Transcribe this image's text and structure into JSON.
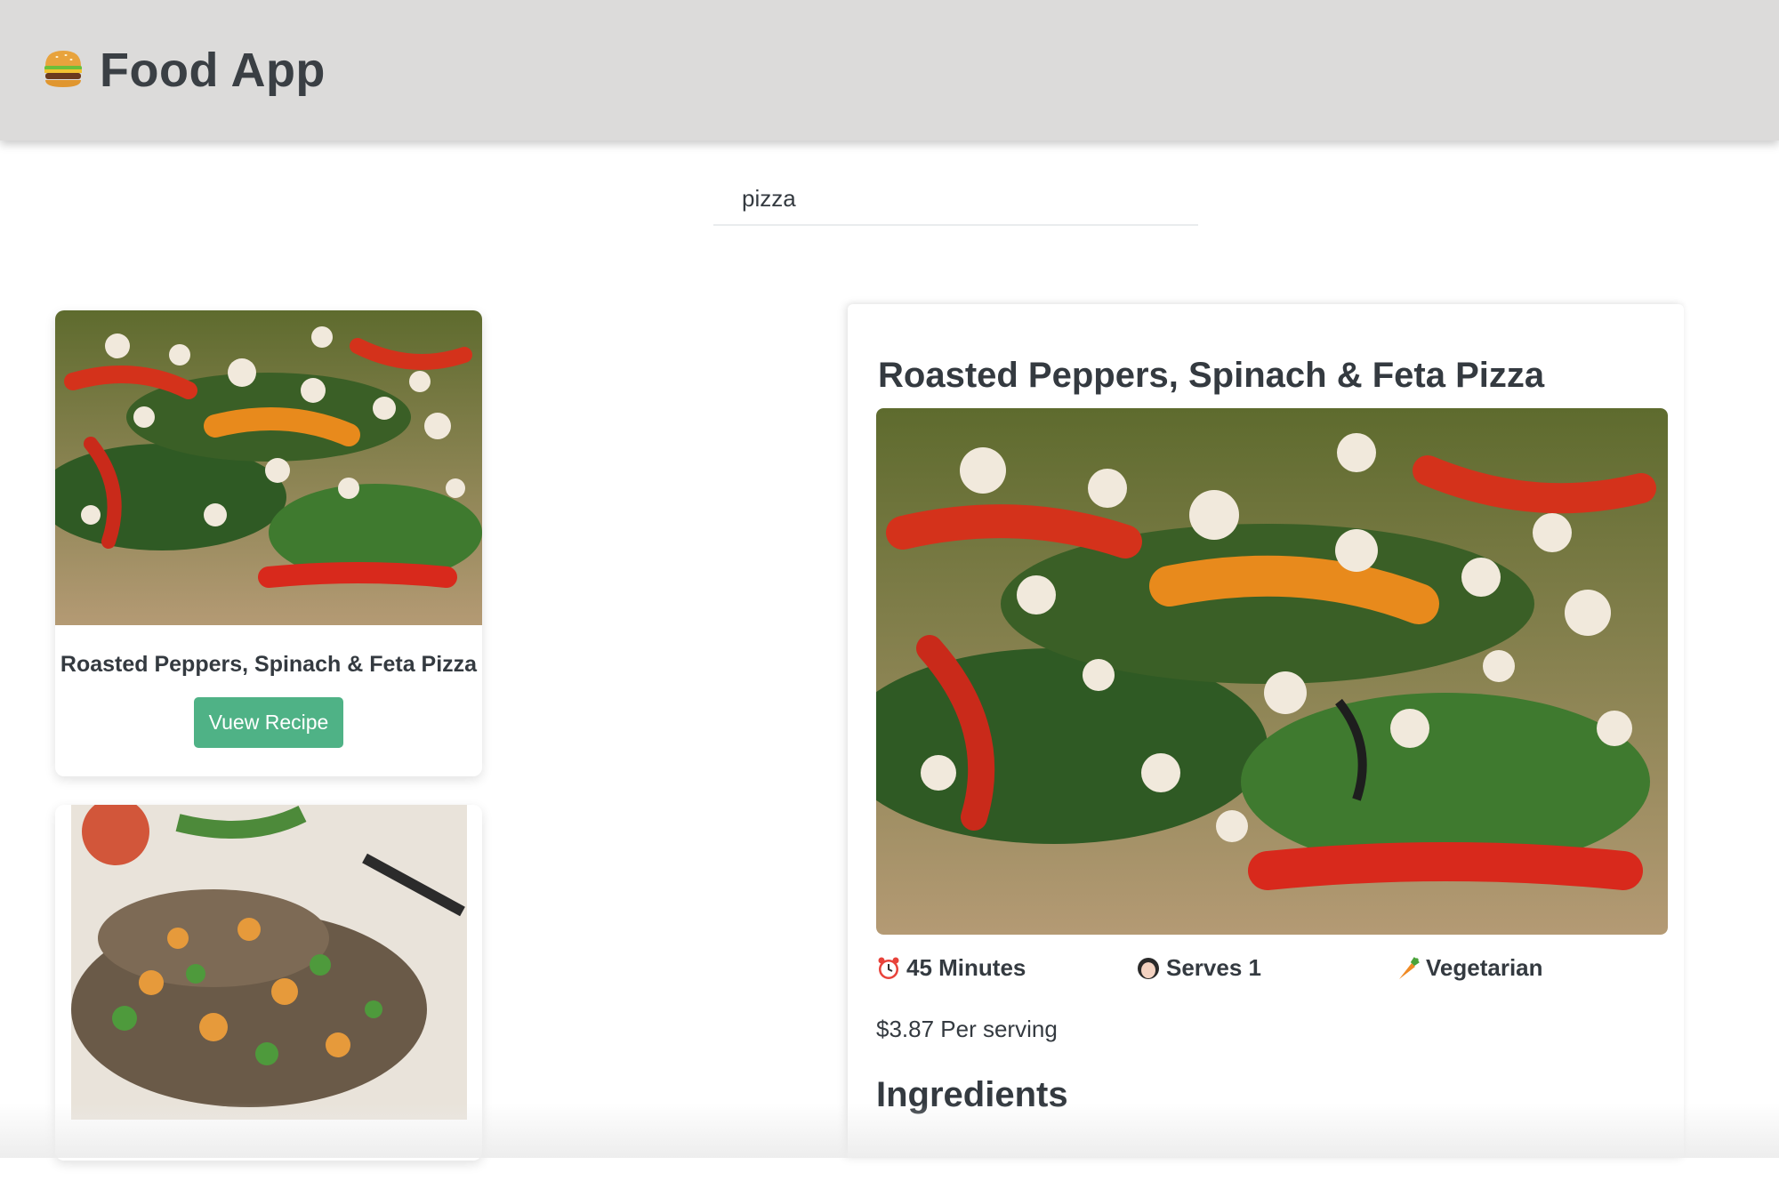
{
  "app": {
    "title": "Food App",
    "logo_icon": "burger-icon"
  },
  "search": {
    "value": "pizza"
  },
  "results": [
    {
      "title": "Roasted Peppers, Spinach & Feta Pizza",
      "button_label": "Vuew Recipe",
      "image_icon": "pizza-photo"
    },
    {
      "title": "",
      "image_icon": "grilled-flatbread-photo"
    }
  ],
  "detail": {
    "title": "Roasted Peppers, Spinach & Feta Pizza",
    "time": "45 Minutes",
    "time_icon": "alarm-clock-icon",
    "serves": "Serves 1",
    "serves_icon": "person-icon",
    "diet": "Vegetarian",
    "diet_icon": "carrot-icon",
    "price": "$3.87 Per serving",
    "ingredients_heading": "Ingredients"
  },
  "colors": {
    "header_bg": "#dcdbda",
    "accent_button": "#4fb286",
    "text": "#343a40"
  }
}
